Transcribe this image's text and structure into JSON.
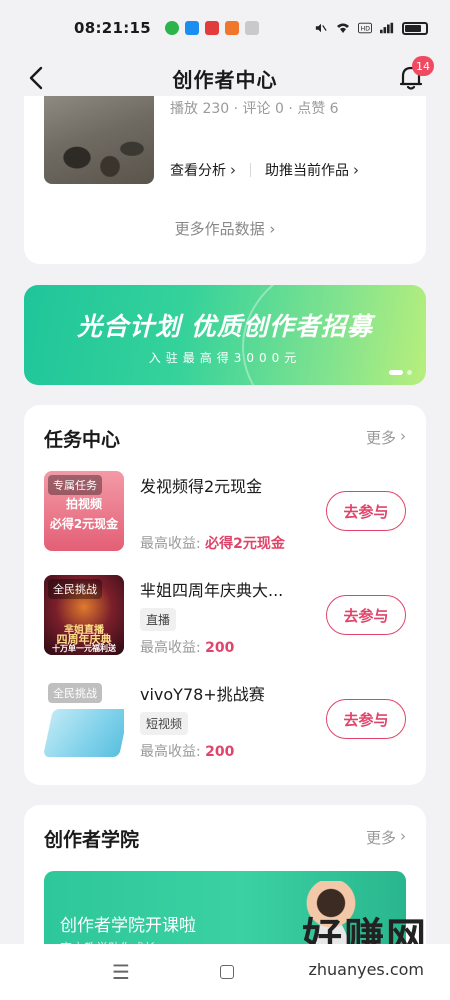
{
  "status": {
    "time": "08:21:15",
    "app_icons": [
      "#2bb44a",
      "#1c8ef0",
      "#e23b3b",
      "#f0772b",
      "#c9c9c9"
    ]
  },
  "header": {
    "title": "创作者中心",
    "notification_count": "14"
  },
  "work_card": {
    "stats": "播放 230 · 评论 0 · 点赞 6",
    "analyze_label": "查看分析",
    "promote_label": "助推当前作品",
    "more_data_label": "更多作品数据"
  },
  "banner": {
    "title": "光合计划 优质创作者招募",
    "subtitle": "入驻最高得3000元"
  },
  "task_center": {
    "title": "任务中心",
    "more_label": "更多",
    "income_prefix": "最高收益:",
    "items": [
      {
        "tag": "专属任务",
        "thumb_line1": "拍视频",
        "thumb_line2": "必得2元现金",
        "title": "发视频得2元现金",
        "label": "",
        "income": "必得2元现金",
        "button": "去参与"
      },
      {
        "tag": "全民挑战",
        "thumb_line1": "芈姐直播",
        "thumb_line2": "四周年庆典",
        "thumb_line3": "十万单一元福利送",
        "title": "芈姐四周年庆典大...",
        "label": "直播",
        "income": "200",
        "button": "去参与"
      },
      {
        "tag": "全民挑战",
        "title": "vivoY78+挑战赛",
        "label": "短视频",
        "income": "200",
        "button": "去参与"
      }
    ]
  },
  "academy": {
    "title": "创作者学院",
    "more_label": "更多",
    "banner_text": "创作者学院开课啦",
    "banner_sub": "官方教学助你成长"
  },
  "watermark": {
    "text": "好赚网",
    "url": "zhuanyes.com"
  }
}
